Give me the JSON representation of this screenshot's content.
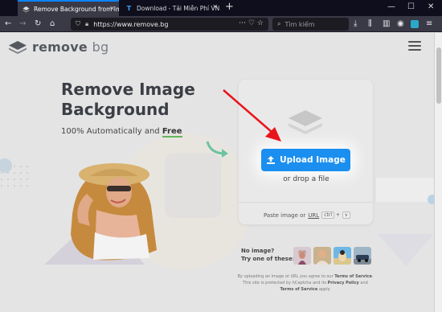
{
  "browser": {
    "tabs": [
      {
        "title": "Remove Background from Ima",
        "active": true
      },
      {
        "title": "Download - Tải Miễn Phí VN - P",
        "active": false
      }
    ],
    "url": "https://www.remove.bg",
    "search_placeholder": "Tìm kiếm"
  },
  "site": {
    "logo_main": "remove",
    "logo_suffix": "bg",
    "headline_line1": "Remove Image",
    "headline_line2": "Background",
    "subhead_prefix": "100% Automatically and ",
    "subhead_emphasis": "Free"
  },
  "upload": {
    "button_label": "Upload Image",
    "drop_label": "or drop a file",
    "paste_prefix": "Paste image or",
    "paste_url": "URL",
    "key1": "ctrl",
    "key_plus": "+",
    "key2": "v"
  },
  "samples": {
    "line1": "No image?",
    "line2": "Try one of these:"
  },
  "legal": {
    "line1": "By uploading an image or URL you agree to our",
    "terms": "Terms of Service",
    "line2": "This site is protected by hCaptcha and its",
    "privacy": "Privacy Policy",
    "and": "and",
    "terms2": "Terms of Service",
    "apply": "apply."
  },
  "colors": {
    "accent": "#1a8ff0",
    "annotation_arrow": "#e8141a",
    "free_underline": "#62b65d"
  }
}
